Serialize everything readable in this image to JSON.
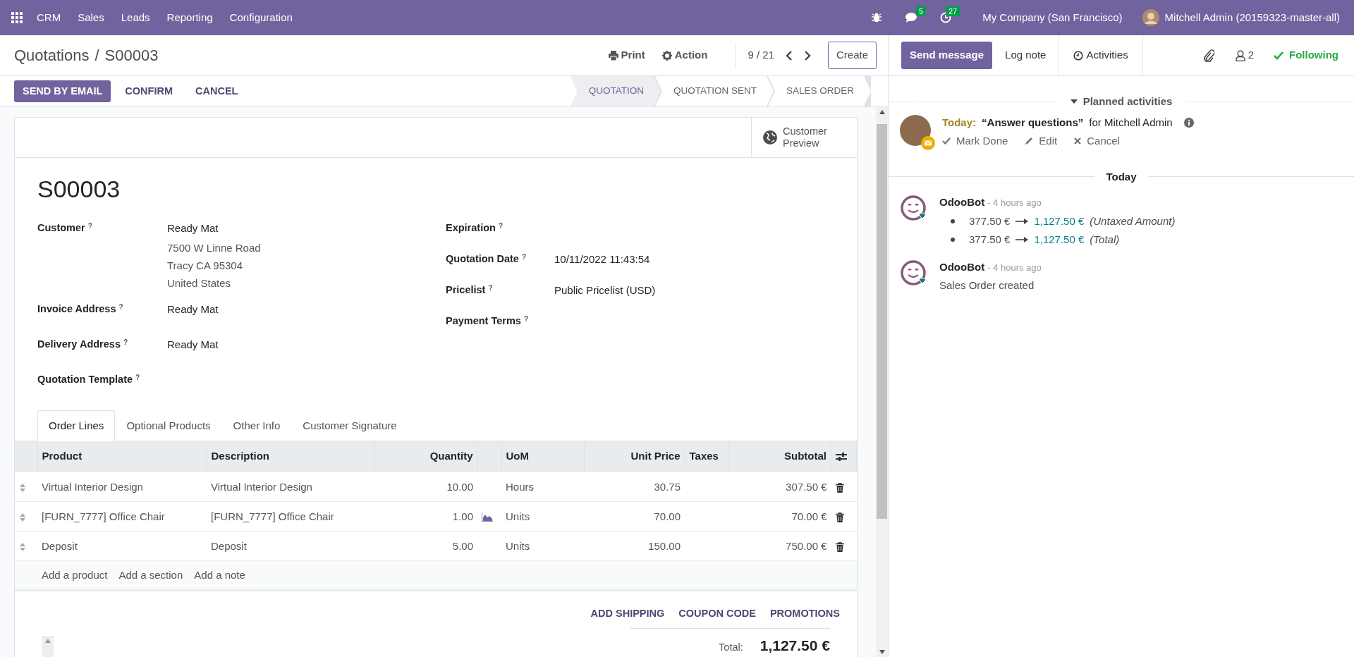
{
  "navbar": {
    "app_name": "CRM",
    "menu": [
      "Sales",
      "Leads",
      "Reporting",
      "Configuration"
    ],
    "messages_count": "5",
    "activities_count": "27",
    "company": "My Company (San Francisco)",
    "user": "Mitchell Admin (20159323-master-all)"
  },
  "control_panel": {
    "breadcrumb_parent": "Quotations",
    "breadcrumb_separator": "/",
    "breadcrumb_current": "S00003",
    "print": "Print",
    "action": "Action",
    "pager": "9 / 21",
    "create": "Create"
  },
  "header_buttons": [
    {
      "label": "SEND BY EMAIL",
      "kind": "primary"
    },
    {
      "label": "CONFIRM",
      "kind": "secondary"
    },
    {
      "label": "CANCEL",
      "kind": "secondary"
    }
  ],
  "stages": [
    {
      "label": "QUOTATION",
      "selected": true
    },
    {
      "label": "QUOTATION SENT",
      "selected": false
    },
    {
      "label": "SALES ORDER",
      "selected": false
    }
  ],
  "sheet": {
    "smart_button": "Customer Preview",
    "title": "S00003",
    "left_fields": [
      {
        "label": "Customer",
        "help": "?",
        "values": [
          "Ready Mat"
        ],
        "address": [
          "7500 W Linne Road",
          "Tracy CA 95304",
          "United States"
        ]
      },
      {
        "label": "Invoice Address",
        "help": "?",
        "values": [
          "Ready Mat"
        ]
      },
      {
        "label": "Delivery Address",
        "help": "?",
        "values": [
          "Ready Mat"
        ]
      },
      {
        "label": "Quotation Template",
        "help": "?"
      }
    ],
    "right_fields": [
      {
        "label": "Expiration",
        "help": "?"
      },
      {
        "label": "Quotation Date",
        "help": "?",
        "values": [
          "10/11/2022 11:43:54"
        ]
      },
      {
        "label": "Pricelist",
        "help": "?",
        "values": [
          "Public Pricelist (USD)"
        ]
      },
      {
        "label": "Payment Terms",
        "help": "?"
      }
    ],
    "tabs": [
      {
        "label": "Order Lines",
        "selected": true
      },
      {
        "label": "Optional Products",
        "selected": false
      },
      {
        "label": "Other Info",
        "selected": false
      },
      {
        "label": "Customer Signature",
        "selected": false
      }
    ],
    "columns": {
      "product": "Product",
      "description": "Description",
      "quantity": "Quantity",
      "uom": "UoM",
      "unit_price": "Unit Price",
      "taxes": "Taxes",
      "subtotal": "Subtotal"
    },
    "lines": [
      {
        "product": "Virtual Interior Design",
        "description": "Virtual Interior Design",
        "quantity": "10.00",
        "forecast": false,
        "uom": "Hours",
        "unit_price": "30.75",
        "subtotal": "307.50 €"
      },
      {
        "product": "[FURN_7777] Office Chair",
        "description": "[FURN_7777] Office Chair",
        "quantity": "1.00",
        "forecast": true,
        "uom": "Units",
        "unit_price": "70.00",
        "subtotal": "70.00 €"
      },
      {
        "product": "Deposit",
        "description": "Deposit",
        "quantity": "5.00",
        "forecast": false,
        "uom": "Units",
        "unit_price": "150.00",
        "subtotal": "750.00 €"
      }
    ],
    "add_links": [
      "Add a product",
      "Add a section",
      "Add a note"
    ],
    "footer_buttons": [
      "ADD SHIPPING",
      "COUPON CODE",
      "PROMOTIONS"
    ],
    "total_label": "Total:",
    "total": "1,127.50 €"
  },
  "chatter": {
    "send_message": "Send message",
    "log_note": "Log note",
    "activities": "Activities",
    "followers_count": "2",
    "following": "Following",
    "planned_header": "Planned activities",
    "activity": {
      "due": "Today:",
      "summary": "“Answer questions”",
      "assignee": "for Mitchell Admin",
      "actions": [
        "Mark Done",
        "Edit",
        "Cancel"
      ]
    },
    "date_separator": "Today",
    "messages": [
      {
        "author": "OdooBot",
        "time": "- 4 hours ago",
        "kind": "tracking",
        "changes": [
          {
            "old": "377.50 €",
            "new": "1,127.50 €",
            "field": "(Untaxed Amount)"
          },
          {
            "old": "377.50 €",
            "new": "1,127.50 €",
            "field": "(Total)"
          }
        ]
      },
      {
        "author": "OdooBot",
        "time": "- 4 hours ago",
        "kind": "text",
        "body": "Sales Order created"
      }
    ]
  }
}
